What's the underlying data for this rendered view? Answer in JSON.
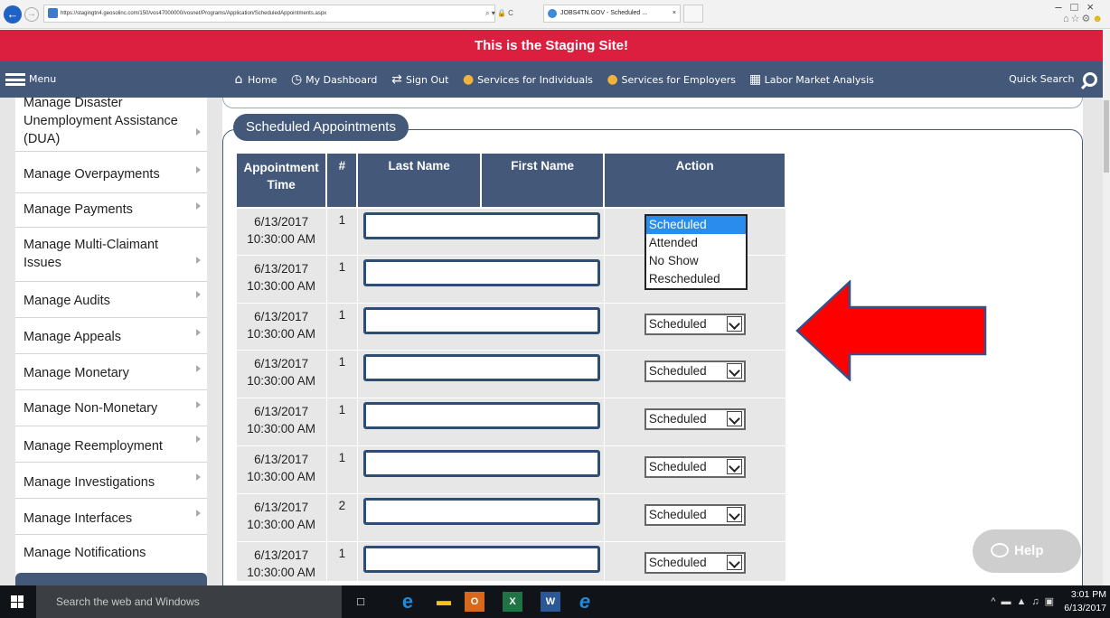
{
  "browser": {
    "url": "https://stagingtn4.geosolinc.com/150/vos47000000/vosnet/Programs/Application/ScheduledAppointments.aspx",
    "tab_title": "JOBS4TN.GOV - Scheduled ...",
    "tab_close": "×",
    "address_tools": "⌕ ▾ 🔒 C"
  },
  "banner": {
    "text": "This is the Staging Site!"
  },
  "nav": {
    "menu_label": "Menu",
    "links": [
      {
        "label": "Home",
        "icon": "home-icon"
      },
      {
        "label": "My Dashboard",
        "icon": "dashboard-icon"
      },
      {
        "label": "Sign Out",
        "icon": "sign-out-icon"
      },
      {
        "label": "Services for Individuals",
        "icon": "person-icon"
      },
      {
        "label": "Services for Employers",
        "icon": "group-icon"
      },
      {
        "label": "Labor Market Analysis",
        "icon": "chart-icon"
      }
    ],
    "quick_search": "Quick Search"
  },
  "sidebar": {
    "items": [
      {
        "label": "Manage Disaster Unemployment Assistance (DUA)"
      },
      {
        "label": "Manage Overpayments"
      },
      {
        "label": "Manage Payments"
      },
      {
        "label": "Manage Multi-Claimant Issues"
      },
      {
        "label": "Manage Audits"
      },
      {
        "label": "Manage Appeals"
      },
      {
        "label": "Manage Monetary"
      },
      {
        "label": "Manage Non-Monetary"
      },
      {
        "label": "Manage Reemployment"
      },
      {
        "label": "Manage Investigations"
      },
      {
        "label": "Manage Interfaces"
      },
      {
        "label": "Manage Notifications"
      }
    ]
  },
  "appointments": {
    "legend": "Scheduled Appointments",
    "columns": {
      "time": "Appointment Time",
      "num": "#",
      "last_name": "Last Name",
      "first_name": "First Name",
      "action": "Action"
    },
    "rows": [
      {
        "date": "6/13/2017",
        "time": "10:30:00 AM",
        "num": "1",
        "action": "Scheduled"
      },
      {
        "date": "6/13/2017",
        "time": "10:30:00 AM",
        "num": "1",
        "action": "Scheduled"
      },
      {
        "date": "6/13/2017",
        "time": "10:30:00 AM",
        "num": "1",
        "action": "Scheduled"
      },
      {
        "date": "6/13/2017",
        "time": "10:30:00 AM",
        "num": "1",
        "action": "Scheduled"
      },
      {
        "date": "6/13/2017",
        "time": "10:30:00 AM",
        "num": "1",
        "action": "Scheduled"
      },
      {
        "date": "6/13/2017",
        "time": "10:30:00 AM",
        "num": "1",
        "action": "Scheduled"
      },
      {
        "date": "6/13/2017",
        "time": "10:30:00 AM",
        "num": "2",
        "action": "Scheduled"
      },
      {
        "date": "6/13/2017",
        "time": "10:30:00 AM",
        "num": "1",
        "action": "Scheduled"
      }
    ],
    "dropdown_options": [
      "Scheduled",
      "Attended",
      "No Show",
      "Rescheduled"
    ]
  },
  "help": {
    "label": "Help"
  },
  "taskbar": {
    "search_placeholder": "Search the web and Windows",
    "time": "3:01 PM",
    "date": "6/13/2017"
  },
  "colors": {
    "banner": "#dc1f3f",
    "nav": "#44597a",
    "annotation_arrow": "#ff0000",
    "selected_option": "#2a8cec"
  }
}
